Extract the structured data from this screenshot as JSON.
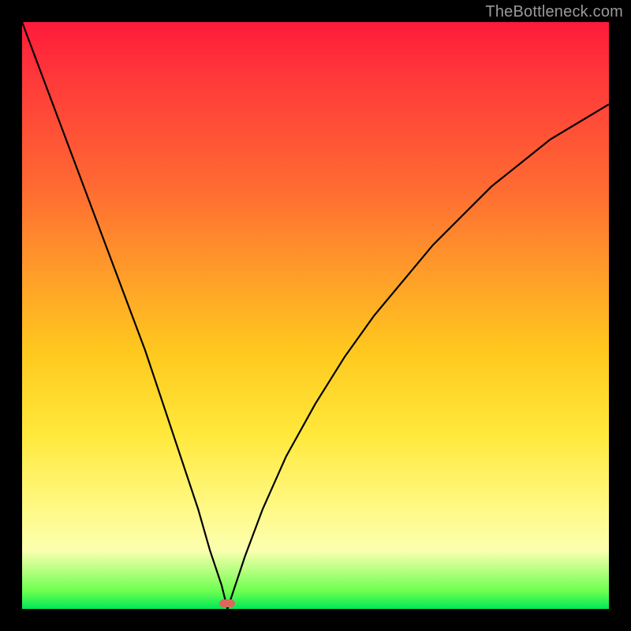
{
  "attribution": "TheBottleneck.com",
  "chart_data": {
    "type": "line",
    "title": "",
    "xlabel": "",
    "ylabel": "",
    "x_range": [
      0,
      100
    ],
    "y_range": [
      0,
      100
    ],
    "min_x": 35,
    "min_y": 0,
    "marker": {
      "x": 35,
      "y": 1
    },
    "series": [
      {
        "name": "bottleneck-curve",
        "x": [
          0,
          3,
          6,
          9,
          12,
          15,
          18,
          21,
          24,
          27,
          30,
          32,
          34,
          35,
          36,
          38,
          41,
          45,
          50,
          55,
          60,
          65,
          70,
          75,
          80,
          85,
          90,
          95,
          100
        ],
        "y": [
          100,
          92,
          84,
          76,
          68,
          60,
          52,
          44,
          35,
          26,
          17,
          10,
          4,
          0,
          3,
          9,
          17,
          26,
          35,
          43,
          50,
          56,
          62,
          67,
          72,
          76,
          80,
          83,
          86
        ]
      }
    ],
    "background_gradient": {
      "stops": [
        {
          "pos": 0.0,
          "color": "#ff1a3a"
        },
        {
          "pos": 0.1,
          "color": "#ff3a3a"
        },
        {
          "pos": 0.28,
          "color": "#ff6a32"
        },
        {
          "pos": 0.42,
          "color": "#ff9a2a"
        },
        {
          "pos": 0.56,
          "color": "#ffc81e"
        },
        {
          "pos": 0.7,
          "color": "#ffe83a"
        },
        {
          "pos": 0.82,
          "color": "#fff880"
        },
        {
          "pos": 0.9,
          "color": "#fcffb0"
        },
        {
          "pos": 0.97,
          "color": "#6cff50"
        },
        {
          "pos": 1.0,
          "color": "#00e858"
        }
      ]
    }
  }
}
